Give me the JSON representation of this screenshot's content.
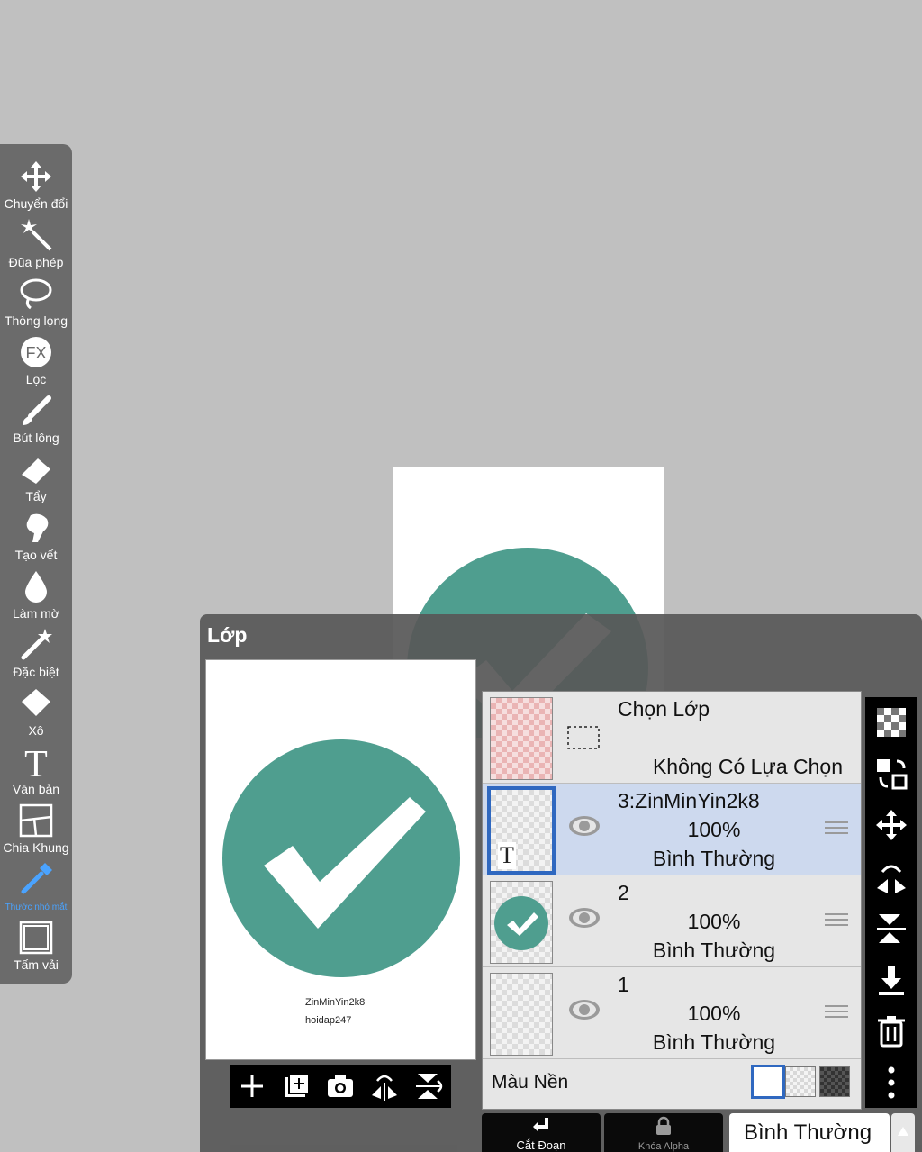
{
  "toolbar": {
    "items": [
      {
        "label": "Chuyển đổi",
        "icon": "move-arrows-icon"
      },
      {
        "label": "Đũa phép",
        "icon": "magic-wand-icon"
      },
      {
        "label": "Thòng lọng",
        "icon": "lasso-icon"
      },
      {
        "label": "Lọc",
        "icon": "fx-filter-icon",
        "icon_text": "FX"
      },
      {
        "label": "Bút lông",
        "icon": "brush-icon"
      },
      {
        "label": "Tẩy",
        "icon": "eraser-icon"
      },
      {
        "label": "Tạo vết",
        "icon": "smudge-icon"
      },
      {
        "label": "Làm mờ",
        "icon": "blur-drop-icon"
      },
      {
        "label": "Đặc biệt",
        "icon": "special-wand-icon"
      },
      {
        "label": "Xô",
        "icon": "bucket-icon"
      },
      {
        "label": "Văn bản",
        "icon": "text-tool-icon",
        "icon_text": "T"
      },
      {
        "label": "Chia Khung",
        "icon": "frame-divider-icon"
      },
      {
        "label": "Thước nhỏ mắt",
        "icon": "eyedropper-icon",
        "active": true
      },
      {
        "label": "Tấm vải",
        "icon": "canvas-icon"
      }
    ]
  },
  "layer_panel": {
    "title": "Lớp",
    "preview": {
      "caption_line1": "ZinMinYin2k8",
      "caption_line2": "hoidap247"
    },
    "selection_row": {
      "title": "Chọn Lớp",
      "subtitle": "Không Có Lựa Chọn"
    },
    "layers": [
      {
        "name": "3:ZinMinYin2k8",
        "opacity": "100%",
        "mode": "Bình Thường",
        "selected": true,
        "thumb_text": "T"
      },
      {
        "name": "2",
        "opacity": "100%",
        "mode": "Bình Thường",
        "selected": false
      },
      {
        "name": "1",
        "opacity": "100%",
        "mode": "Bình Thường",
        "selected": false
      }
    ],
    "background": {
      "label": "Màu Nền"
    },
    "bottom": {
      "clip_label": "Cắt Đoạn",
      "alpha_lock_label": "Khóa Alpha",
      "blend_mode": "Bình Thường"
    }
  },
  "colors": {
    "accent_blue": "#2f68c0",
    "teal": "#4f9e8f",
    "active_tool": "#4aa3ff"
  }
}
